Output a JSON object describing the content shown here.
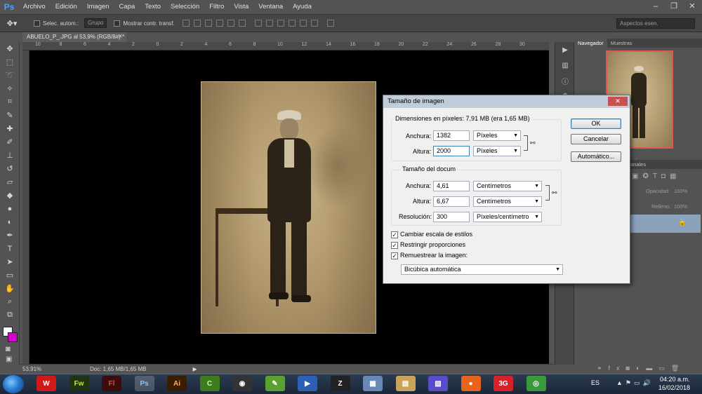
{
  "app": {
    "logo": "Ps"
  },
  "menu": [
    "Archivo",
    "Edición",
    "Imagen",
    "Capa",
    "Texto",
    "Selección",
    "Filtro",
    "Vista",
    "Ventana",
    "Ayuda"
  ],
  "options": {
    "auto_select_label": "Selec. autom.:",
    "auto_select_value": "Grupo",
    "transform_label": "Mostrar contr. transf.",
    "workspace": "Aspectos esen."
  },
  "document": {
    "tab_title": "ABUELO_P_.JPG al 53,9% (RGB/8#) *",
    "ruler_ticks": [
      "10",
      "8",
      "6",
      "4",
      "2",
      "0",
      "2",
      "4",
      "6",
      "8",
      "10",
      "12",
      "14",
      "16",
      "18",
      "20",
      "22",
      "24",
      "26",
      "28",
      "30"
    ]
  },
  "status": {
    "zoom": "53,91%",
    "doc_size": "Doc: 1,65 MB/1,65 MB"
  },
  "panels": {
    "navigator_tab": "Navegador",
    "swatches_tab": "Muestras",
    "channels_tab": "anales",
    "opacity_label": "Opacidad:",
    "opacity_value": "100%",
    "fill_label": "Relleno:",
    "fill_value": "100%"
  },
  "dialog": {
    "title": "Tamaño de imagen",
    "pixel_dims_label": "Dimensiones en píxeles: 7,91 MB (era 1,65 MB)",
    "width_label": "Anchura:",
    "width_value": "1382",
    "width_unit": "Píxeles",
    "height_label": "Altura:",
    "height_value": "2000",
    "height_unit": "Píxeles",
    "doc_size_label": "Tamaño del docum",
    "doc_width_label": "Anchura:",
    "doc_width_value": "4,61",
    "doc_width_unit": "Centímetros",
    "doc_height_label": "Altura:",
    "doc_height_value": "6,67",
    "doc_height_unit": "Centímetros",
    "resolution_label": "Resolución:",
    "resolution_value": "300",
    "resolution_unit": "Píxeles/centímetro",
    "scale_styles": "Cambiar escala de estilos",
    "constrain": "Restringir proporciones",
    "resample": "Remuestrear la imagen:",
    "resample_method": "Bicúbica automática",
    "ok": "OK",
    "cancel": "Cancelar",
    "auto": "Automático..."
  },
  "taskbar": {
    "apps": [
      "W",
      "Fw",
      "Fl",
      "Ps",
      "Ai",
      "C",
      "◉",
      "✎",
      "▶",
      "Z",
      "▦",
      "▤",
      "▧",
      "●",
      "3G",
      "◎"
    ],
    "lang": "ES",
    "time": "04:20 a.m.",
    "date": "16/02/2018"
  },
  "colors": {
    "accent": "#3c7fb1",
    "foreground": "#ffffff",
    "background": "#d400d4"
  }
}
